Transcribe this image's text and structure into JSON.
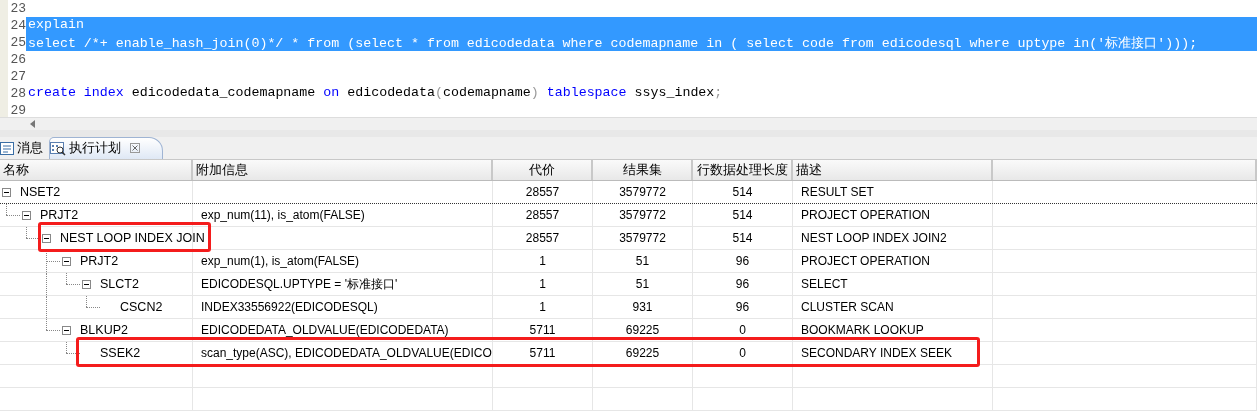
{
  "editor": {
    "lines": [
      {
        "number": "23",
        "selected": false
      },
      {
        "number": "24",
        "selected": true,
        "tokens": [
          {
            "text": "explain",
            "kind": "plain"
          }
        ]
      },
      {
        "number": "25",
        "selected": true,
        "tokens": [
          {
            "text": "select /*+ enable_hash_join(0)*/ * from (select * from edicodedata where codemapname in ( select code from edicodesql where uptype in('标准接口')));",
            "kind": "plain"
          }
        ]
      },
      {
        "number": "26",
        "selected": false
      },
      {
        "number": "27",
        "selected": false
      },
      {
        "number": "28",
        "selected": false,
        "tokens": [
          {
            "text": "create",
            "kind": "keyword"
          },
          {
            "text": " index",
            "kind": "keyword"
          },
          {
            "text": " edicodedata_codemapname ",
            "kind": "plain"
          },
          {
            "text": "on",
            "kind": "keyword"
          },
          {
            "text": " edicodedata",
            "kind": "plain"
          },
          {
            "text": "(",
            "kind": "punct"
          },
          {
            "text": "codemapname",
            "kind": "plain"
          },
          {
            "text": ")",
            "kind": "punct"
          },
          {
            "text": " tablespace",
            "kind": "keyword"
          },
          {
            "text": " ssys_index",
            "kind": "plain"
          },
          {
            "text": ";",
            "kind": "punct"
          }
        ]
      },
      {
        "number": "29",
        "selected": false
      }
    ]
  },
  "tabs": [
    {
      "label": "消息",
      "selected": false,
      "closable": false
    },
    {
      "label": "执行计划",
      "selected": true,
      "closable": true
    }
  ],
  "table": {
    "columns": [
      "名称",
      "附加信息",
      "代价",
      "结果集",
      "行数据处理长度",
      "描述"
    ],
    "rows": [
      {
        "name": "NSET2",
        "cost": "28557",
        "result": "3579772",
        "row_length": "514",
        "description": "RESULT SET",
        "expanded": true,
        "focused": true,
        "children": [
          {
            "name": "PRJT2",
            "info": "exp_num(11), is_atom(FALSE)",
            "cost": "28557",
            "result": "3579772",
            "row_length": "514",
            "description": "PROJECT OPERATION",
            "expanded": true,
            "focused": false,
            "children": [
              {
                "name": "NEST LOOP INDEX JOIN",
                "cost": "28557",
                "result": "3579772",
                "row_length": "514",
                "description": "NEST LOOP INDEX JOIN2",
                "expanded": true,
                "focused": false,
                "name_highlighted": true,
                "children": [
                  {
                    "name": "PRJT2",
                    "info": "exp_num(1), is_atom(FALSE)",
                    "cost": "1",
                    "result": "51",
                    "row_length": "96",
                    "description": "PROJECT OPERATION",
                    "expanded": true,
                    "focused": false,
                    "children": [
                      {
                        "name": "SLCT2",
                        "info": "EDICODESQL.UPTYPE = '标准接口'",
                        "cost": "1",
                        "result": "51",
                        "row_length": "96",
                        "description": "SELECT",
                        "expanded": true,
                        "focused": false,
                        "children": [
                          {
                            "name": "CSCN2",
                            "info": "INDEX33556922(EDICODESQL)",
                            "cost": "1",
                            "result": "931",
                            "row_length": "96",
                            "description": "CLUSTER SCAN",
                            "focused": false
                          }
                        ]
                      }
                    ]
                  },
                  {
                    "name": "BLKUP2",
                    "info": "EDICODEDATA_OLDVALUE(EDICODEDATA)",
                    "cost": "5711",
                    "result": "69225",
                    "row_length": "0",
                    "description": "BOOKMARK LOOKUP",
                    "expanded": true,
                    "focused": false,
                    "children": [
                      {
                        "name": "SSEK2",
                        "info": "scan_type(ASC), EDICODEDATA_OLDVALUE(EDICO",
                        "cost": "5711",
                        "result": "69225",
                        "row_length": "0",
                        "description": "SECONDARY INDEX SEEK",
                        "focused": false,
                        "row_highlighted": true
                      }
                    ]
                  }
                ]
              }
            ]
          }
        ]
      }
    ]
  }
}
